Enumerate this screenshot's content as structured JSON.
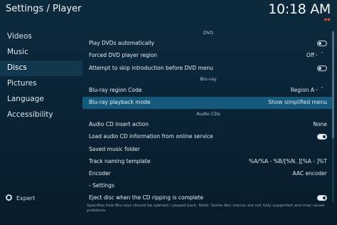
{
  "header": {
    "title": "Settings / Player",
    "clock": "10:18 AM"
  },
  "sidebar": {
    "items": [
      {
        "label": "Videos"
      },
      {
        "label": "Music"
      },
      {
        "label": "Discs"
      },
      {
        "label": "Pictures"
      },
      {
        "label": "Language"
      },
      {
        "label": "Accessibility"
      }
    ],
    "active_index": 2,
    "expert_label": "Expert"
  },
  "sections": {
    "dvd": "DVD",
    "bluray": "Blu-ray",
    "audio_cds": "Audio CDs"
  },
  "rows": {
    "play_dvds": {
      "label": "Play DVDs automatically",
      "toggle": "off"
    },
    "forced_region": {
      "label": "Forced DVD player region",
      "value": "Off"
    },
    "skip_intro": {
      "label": "Attempt to skip introduction before DVD menu",
      "toggle": "off"
    },
    "bluray_region": {
      "label": "Blu-ray region Code",
      "value": "Region A"
    },
    "bluray_playback": {
      "label": "Blu-ray playback mode",
      "value": "Show simplified menu"
    },
    "insert_action": {
      "label": "Audio CD insert action",
      "value": "None"
    },
    "load_info": {
      "label": "Load audio CD information from online service",
      "toggle": "on"
    },
    "saved_folder": {
      "label": "Saved music folder"
    },
    "track_template": {
      "label": "Track naming template",
      "value": "%A/%A - %B/[%N. ][%A - ]%T"
    },
    "encoder": {
      "label": "Encoder",
      "value": "AAC encoder"
    },
    "settings": {
      "label": "- Settings"
    },
    "eject": {
      "label": "Eject disc when the CD ripping is complete",
      "toggle": "on"
    }
  },
  "footer": {
    "line1": "Specifies how Blu-rays should be opened / played back. Note: Some disc menus are not fully supported and may cause",
    "line2": "problems."
  },
  "colors": {
    "highlight": "#155a7d",
    "accent_back": "#e04a4a"
  }
}
